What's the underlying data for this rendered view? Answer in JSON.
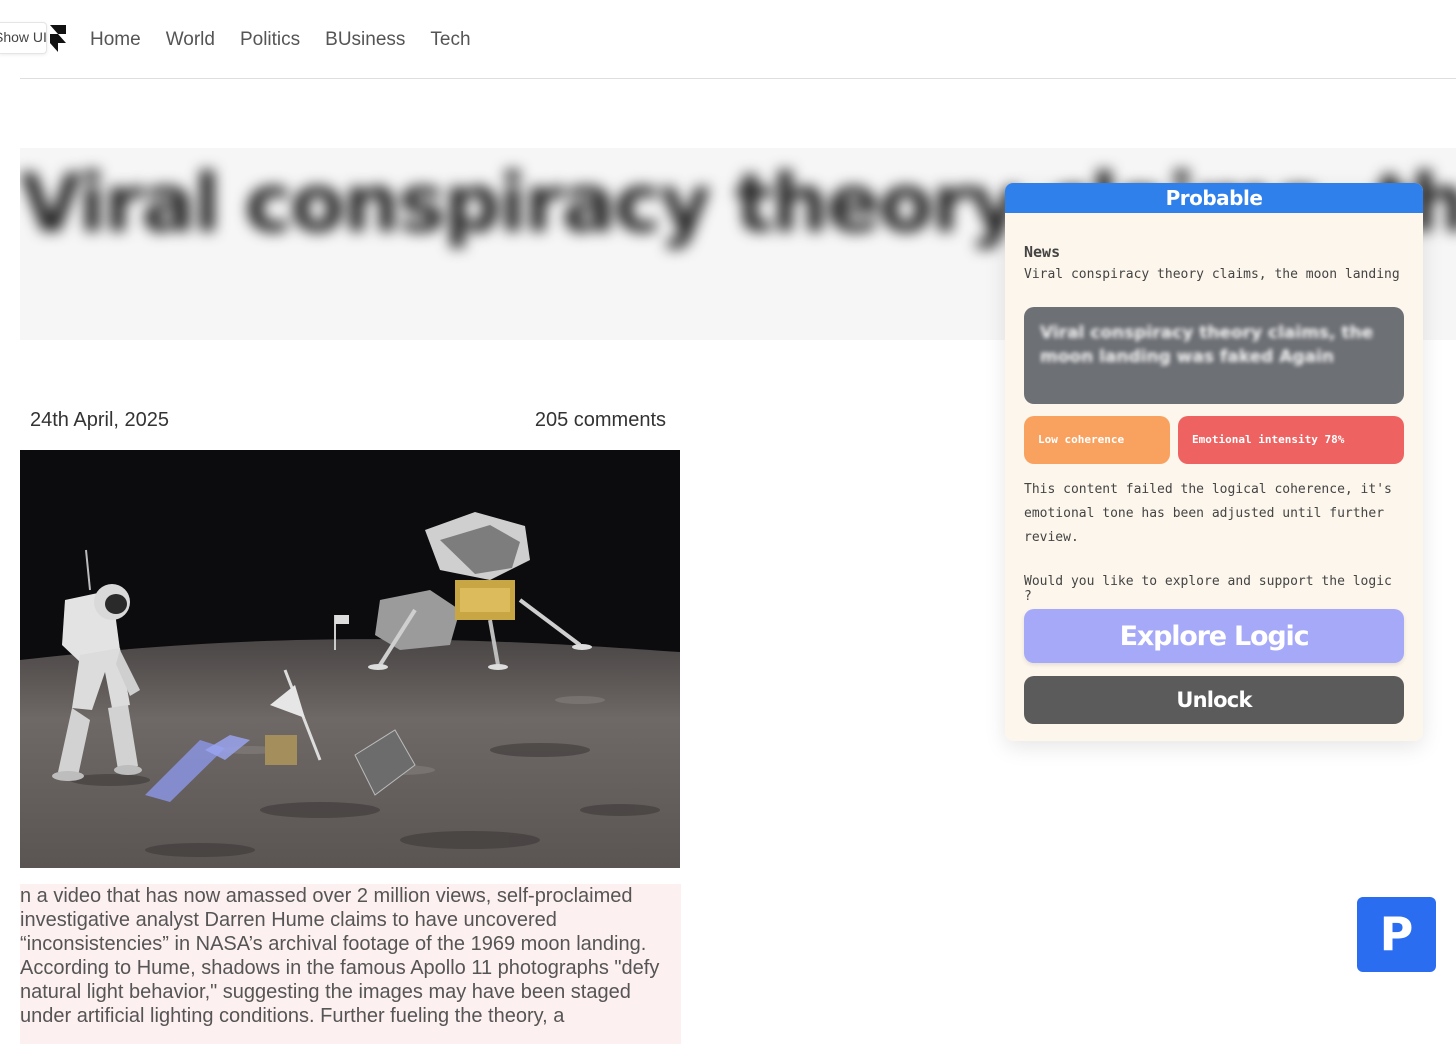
{
  "nav": {
    "show_ui_label": "Show UI",
    "links": [
      "Home",
      "World",
      "Politics",
      "BUsiness",
      "Tech"
    ]
  },
  "article": {
    "headline": "Viral conspiracy theory claims, the moon landing was faked Again",
    "date": "24th April, 2025",
    "comments": "205 comments",
    "body": "n a video that has now amassed over 2 million views, self-proclaimed investigative analyst Darren Hume claims to have uncovered “inconsistencies” in NASA’s archival footage of the 1969 moon landing. According to Hume, shadows in the famous Apollo 11 photographs \"defy natural light behavior,\" suggesting the images may have been staged under artificial lighting conditions.  Further fueling the theory, a"
  },
  "panel": {
    "header": "Probable",
    "section_label": "News",
    "news_line": "Viral conspiracy theory claims, the moon landing was f",
    "preview_text": "Viral conspiracy theory claims, the moon landing was faked Again",
    "badge_low": "Low coherence",
    "badge_emotional": "Emotional intensity 78%",
    "description": "This content failed the logical coherence, it's emotional tone has been adjusted until further review.",
    "question": "Would you like to explore and support the logic ?",
    "explore_label": "Explore Logic",
    "unlock_label": "Unlock",
    "colors": {
      "header": "#2f80ea",
      "low_coherence": "#f9a260",
      "emotional": "#ee6262",
      "explore": "#a5a9f8",
      "unlock": "#5b5b5b"
    }
  },
  "floating": {
    "p_button_label": "P",
    "color": "#2a6df0"
  },
  "icons": {
    "logo": "framer-logo-icon"
  }
}
